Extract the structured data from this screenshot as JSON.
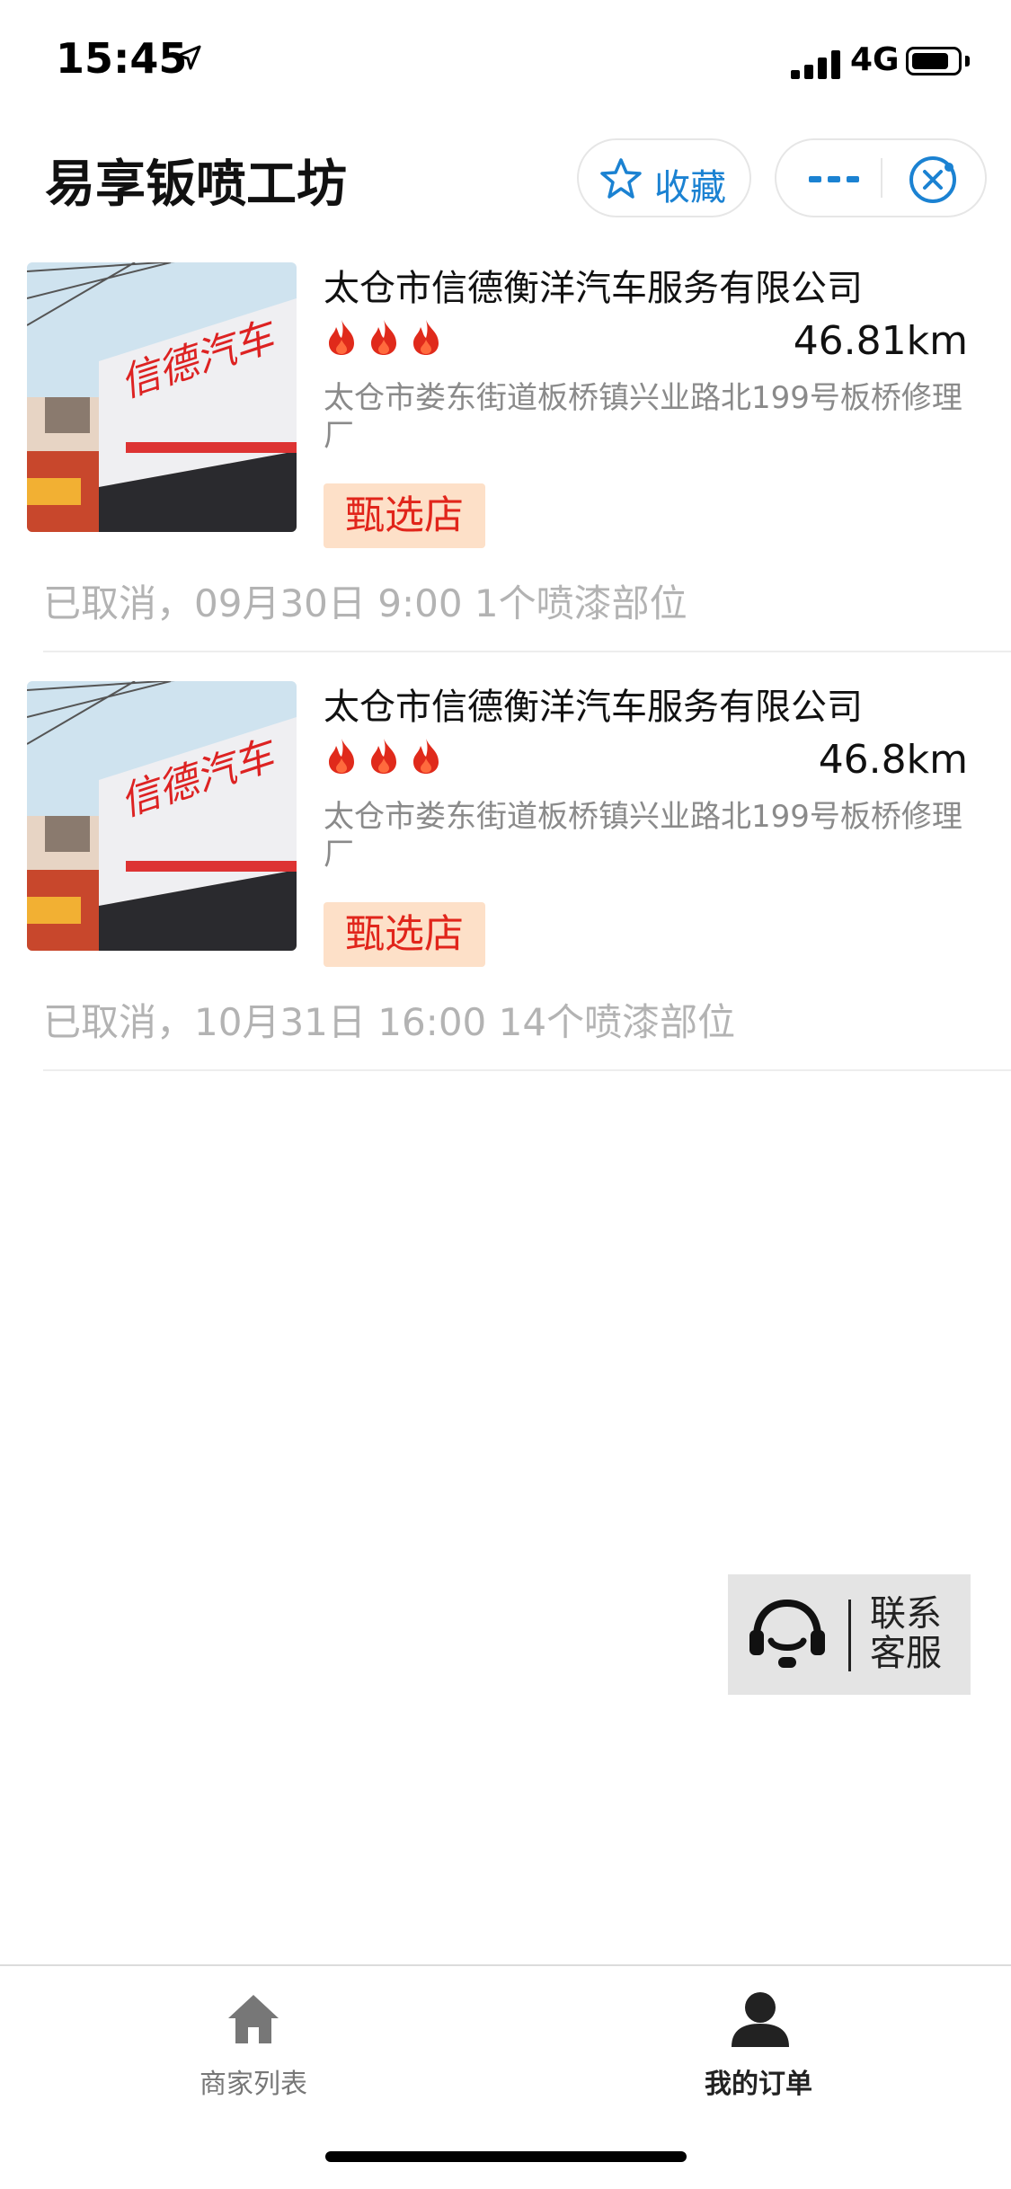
{
  "status_bar": {
    "time": "15:45",
    "network": "4G",
    "battery_level": 0.8
  },
  "nav": {
    "title": "易享钣喷工坊",
    "favorite_label": "收藏",
    "favorite_icon": "star-icon",
    "more_icon": "more-icon",
    "close_icon": "close-icon"
  },
  "orders": [
    {
      "shop_name": "太仓市信德衡洋汽车服务有限公司",
      "rating_flames": 3,
      "distance": "46.81km",
      "address": "太仓市娄东街道板桥镇兴业路北199号板桥修理厂",
      "tag": "甄选店",
      "status_line": "已取消，09月30日 9:00 1个喷漆部位",
      "sign_text": "信德汽车"
    },
    {
      "shop_name": "太仓市信德衡洋汽车服务有限公司",
      "rating_flames": 3,
      "distance": "46.8km",
      "address": "太仓市娄东街道板桥镇兴业路北199号板桥修理厂",
      "tag": "甄选店",
      "status_line": "已取消，10月31日 16:00 14个喷漆部位",
      "sign_text": "信德汽车"
    }
  ],
  "service": {
    "label": "联系客服",
    "line1": "联系",
    "line2": "客服",
    "icon": "headset-icon"
  },
  "tabbar": {
    "tabs": [
      {
        "label": "商家列表",
        "icon": "home-icon",
        "active": false
      },
      {
        "label": "我的订单",
        "icon": "user-icon",
        "active": true
      }
    ],
    "colors": {
      "active": "#222222",
      "inactive": "#777777"
    }
  },
  "colors": {
    "accent": "#1b82d2",
    "tag_bg": "#fde0c8",
    "tag_text": "#e1251b",
    "flame": "#e02a1b",
    "muted_text": "#8a8a8a"
  }
}
